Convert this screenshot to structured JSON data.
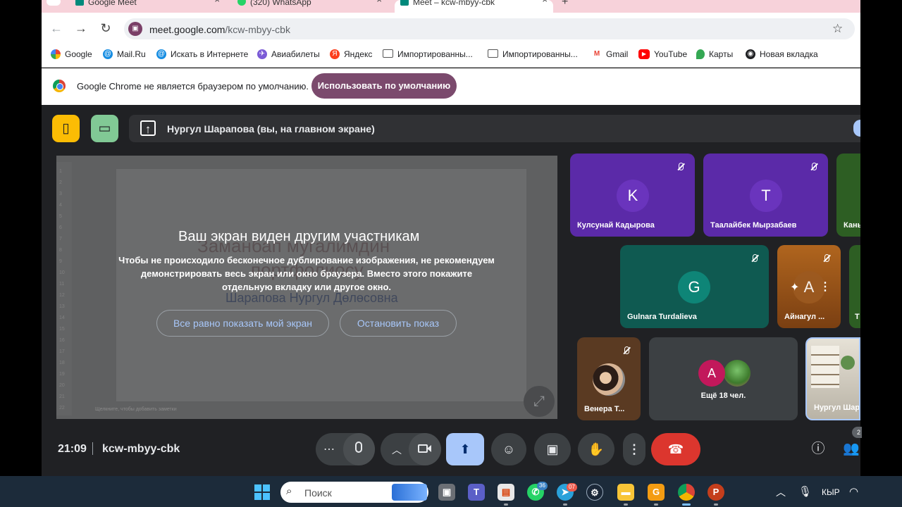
{
  "browser": {
    "tabs": [
      {
        "label": "Google Meet",
        "color": "#00897b"
      },
      {
        "label": "(320) WhatsApp",
        "color": "#25d366"
      },
      {
        "label": "Meet – kcw-mbyy-cbk",
        "color": "#00897b"
      }
    ],
    "new_tab_glyph": "+",
    "url_host": "meet.google.com",
    "url_path": "/kcw-mbyy-cbk",
    "bookmarks": [
      {
        "label": "Google",
        "icon": "google-icon"
      },
      {
        "label": "Mail.Ru",
        "icon": "mailru-icon"
      },
      {
        "label": "Искать в Интернете",
        "icon": "mailru-icon"
      },
      {
        "label": "Авиабилеты",
        "icon": "plane-icon"
      },
      {
        "label": "Яндекс",
        "icon": "yandex-icon"
      },
      {
        "label": "Импортированны...",
        "icon": "folder-icon"
      },
      {
        "label": "Импортированны...",
        "icon": "folder-icon"
      },
      {
        "label": "Gmail",
        "icon": "gmail-icon"
      },
      {
        "label": "YouTube",
        "icon": "youtube-icon"
      },
      {
        "label": "Карты",
        "icon": "maps-icon"
      },
      {
        "label": "Новая вкладка",
        "icon": "newtab-icon"
      }
    ],
    "infobar_text": "Google Chrome не является браузером по умолчанию.",
    "infobar_button": "Использовать по умолчанию"
  },
  "meet": {
    "presenter_text": "Нургул Шарапова (вы, на главном экране)",
    "share": {
      "ghost_title_line1": "Заманбап мугалимдин",
      "ghost_title_line2": "портфолиосу",
      "ghost_name": "Шарапова Нургул Дөлөсовна",
      "overlay_title": "Ваш экран виден другим участникам",
      "overlay_desc": "Чтобы не происходило бесконечное дублирование изображения, не рекомендуем демонстрировать весь экран или окно браузера. Вместо этого покажите отдельную вкладку или другое окно.",
      "btn_show": "Все равно показать мой экран",
      "btn_stop": "Остановить показ",
      "footer": "Щелкните, чтобы добавить заметки",
      "ruler": [
        "1",
        "2",
        "3",
        "4",
        "5",
        "6",
        "7",
        "8",
        "9",
        "10",
        "11",
        "12",
        "13",
        "14",
        "15",
        "16",
        "17",
        "18",
        "19",
        "20",
        "21",
        "22"
      ]
    },
    "participants": [
      {
        "name": "Кулсунай Кадырова",
        "initial": "K",
        "bg": "#5b2aa8",
        "avatar_bg": "#6a34bd"
      },
      {
        "name": "Таалайбек Мырзабаев",
        "initial": "T",
        "bg": "#5b2aa8",
        "avatar_bg": "#6a34bd"
      },
      {
        "name": "Каны",
        "initial": "",
        "bg": "#2d5e23",
        "avatar_bg": "#2d5e23"
      },
      {
        "name": "Gulnara Turdalieva",
        "initial": "G",
        "bg": "#0f5a51",
        "avatar_bg": "#0e8577"
      },
      {
        "name": "Айнагул ...",
        "initial": "A",
        "bg": "#8a4a14",
        "avatar_bg": "#9c5a20"
      },
      {
        "name": "Т",
        "initial": "",
        "bg": "#2d5e23",
        "avatar_bg": "#2d5e23"
      },
      {
        "name": "Венера Т...",
        "initial": "",
        "bg": "#5a3a22",
        "avatar_bg": "#5a3a22"
      },
      {
        "name": "Нургул Шар",
        "initial": "",
        "bg": "#cfc9bd",
        "avatar_bg": "#cfc9bd"
      }
    ],
    "more": {
      "label": "Ещё 18 чел.",
      "initial": "A",
      "initial_bg": "#c2185b"
    },
    "clock": "21:09",
    "meeting_code": "kcw-mbyy-cbk",
    "people_count": "2"
  },
  "taskbar": {
    "search_placeholder": "Поиск",
    "whatsapp_badge": "36",
    "telegram_badge": "07",
    "lang": "КЫР"
  },
  "colors": {
    "meet_bg": "#202124",
    "present_active": "#a8c7fa",
    "leave": "#dc362e",
    "accent_yellow": "#fbbc04",
    "accent_green": "#81c995"
  }
}
